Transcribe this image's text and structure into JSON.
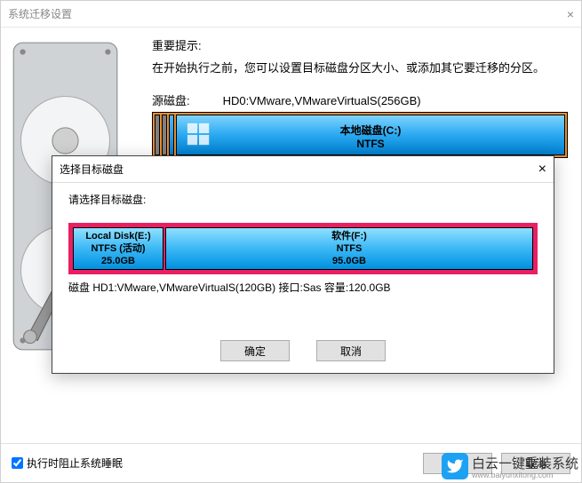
{
  "main": {
    "title": "系统迁移设置",
    "close_glyph": "×",
    "hint_title": "重要提示:",
    "hint_text": "在开始执行之前，您可以设置目标磁盘分区大小、或添加其它要迁移的分区。",
    "source_label": "源磁盘:",
    "source_value": "HD0:VMware,VMwareVirtualS(256GB)",
    "partition_c_name": "本地磁盘(C:)",
    "partition_c_fs": "NTFS"
  },
  "footer": {
    "sleep_checkbox_label": "执行时阻止系统睡眠",
    "start_btn": "开始",
    "cancel_btn": "取消"
  },
  "dialog": {
    "title": "选择目标磁盘",
    "close_glyph": "×",
    "instruction": "请选择目标磁盘:",
    "part_e_name": "Local Disk(E:)",
    "part_e_fs": "NTFS (活动)",
    "part_e_size": "25.0GB",
    "part_f_name": "软件(F:)",
    "part_f_fs": "NTFS",
    "part_f_size": "95.0GB",
    "target_info": "磁盘 HD1:VMware,VMwareVirtualS(120GB)  接口:Sas  容量:120.0GB",
    "ok_btn": "确定",
    "cancel_btn": "取消"
  },
  "watermark": {
    "text": "白云一键重装系统",
    "sub": "www.baiyunxitong.com"
  }
}
